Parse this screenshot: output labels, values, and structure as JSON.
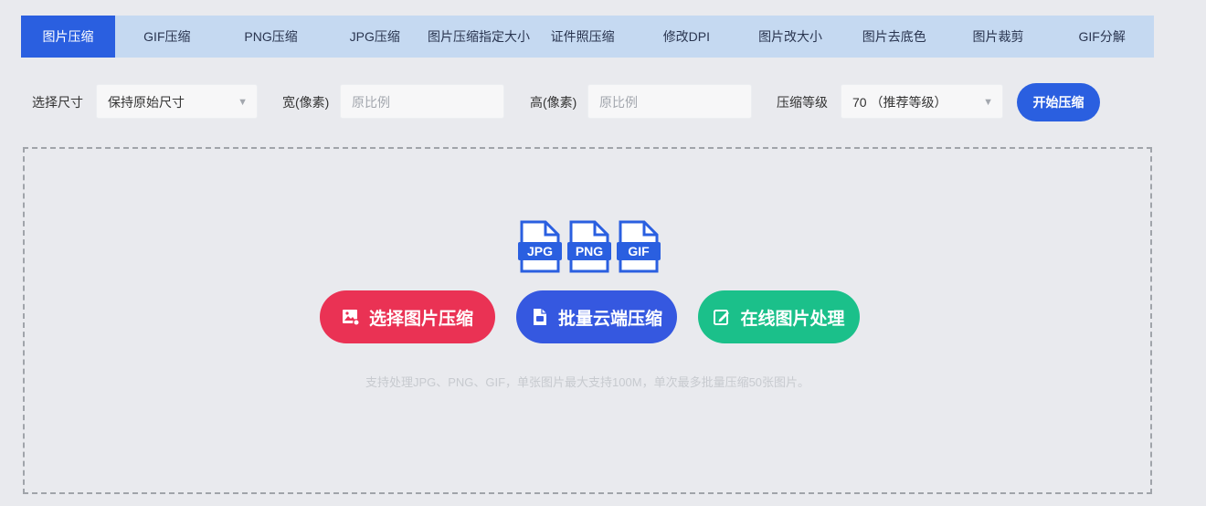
{
  "tabs": [
    {
      "label": "图片压缩",
      "active": true
    },
    {
      "label": "GIF压缩",
      "active": false
    },
    {
      "label": "PNG压缩",
      "active": false
    },
    {
      "label": "JPG压缩",
      "active": false
    },
    {
      "label": "图片压缩指定大小",
      "active": false
    },
    {
      "label": "证件照压缩",
      "active": false
    },
    {
      "label": "修改DPI",
      "active": false
    },
    {
      "label": "图片改大小",
      "active": false
    },
    {
      "label": "图片去底色",
      "active": false
    },
    {
      "label": "图片裁剪",
      "active": false
    },
    {
      "label": "GIF分解",
      "active": false
    }
  ],
  "controls": {
    "size_label": "选择尺寸",
    "size_value": "保持原始尺寸",
    "width_label": "宽(像素)",
    "width_placeholder": "原比例",
    "height_label": "高(像素)",
    "height_placeholder": "原比例",
    "level_label": "压缩等级",
    "level_value": "70 （推荐等级）",
    "start_button": "开始压缩"
  },
  "dropzone": {
    "file_types": [
      "JPG",
      "PNG",
      "GIF"
    ],
    "buttons": [
      {
        "label": "选择图片压缩",
        "color": "#ea3254",
        "icon": "image-icon"
      },
      {
        "label": "批量云端压缩",
        "color": "#3558e0",
        "icon": "cloud-file-icon"
      },
      {
        "label": "在线图片处理",
        "color": "#1bc08a",
        "icon": "edit-icon"
      }
    ],
    "note": "支持处理JPG、PNG、GIF，单张图片最大支持100M，单次最多批量压缩50张图片。"
  },
  "colors": {
    "accent": "#2a5fe0",
    "tabbar": "#c5d9f1",
    "background": "#e9eaee"
  }
}
